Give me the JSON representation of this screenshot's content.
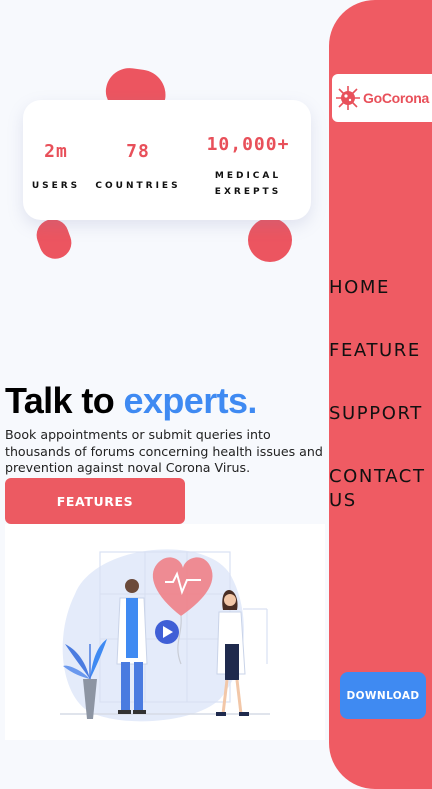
{
  "stats": {
    "users": {
      "value": "2m",
      "label": "USERS"
    },
    "countries": {
      "value": "78",
      "label": "COUNTRIES"
    },
    "medical": {
      "value": "10,000+",
      "label": "MEDICAL EXREPTS"
    }
  },
  "hero": {
    "title_part1": "Talk to ",
    "title_accent": "experts.",
    "description": "Book appointments or submit queries into thousands of forums concerning health issues and prevention against noval Corona Virus.",
    "features_button": "FEATURES"
  },
  "sidebar": {
    "logo_text": "GoCorona",
    "nav": [
      {
        "label": "HOME"
      },
      {
        "label": "FEATURE"
      },
      {
        "label": "SUPPORT"
      },
      {
        "label": "CONTACT US"
      }
    ],
    "download_button": "DOWNLOAD"
  },
  "colors": {
    "brand_red": "#ef5b63",
    "accent_blue": "#3f8af2",
    "background": "#f7f9fd"
  },
  "icons": {
    "logo": "virus-icon",
    "illustration": "doctors-heart-video-illustration",
    "play": "play-icon"
  }
}
